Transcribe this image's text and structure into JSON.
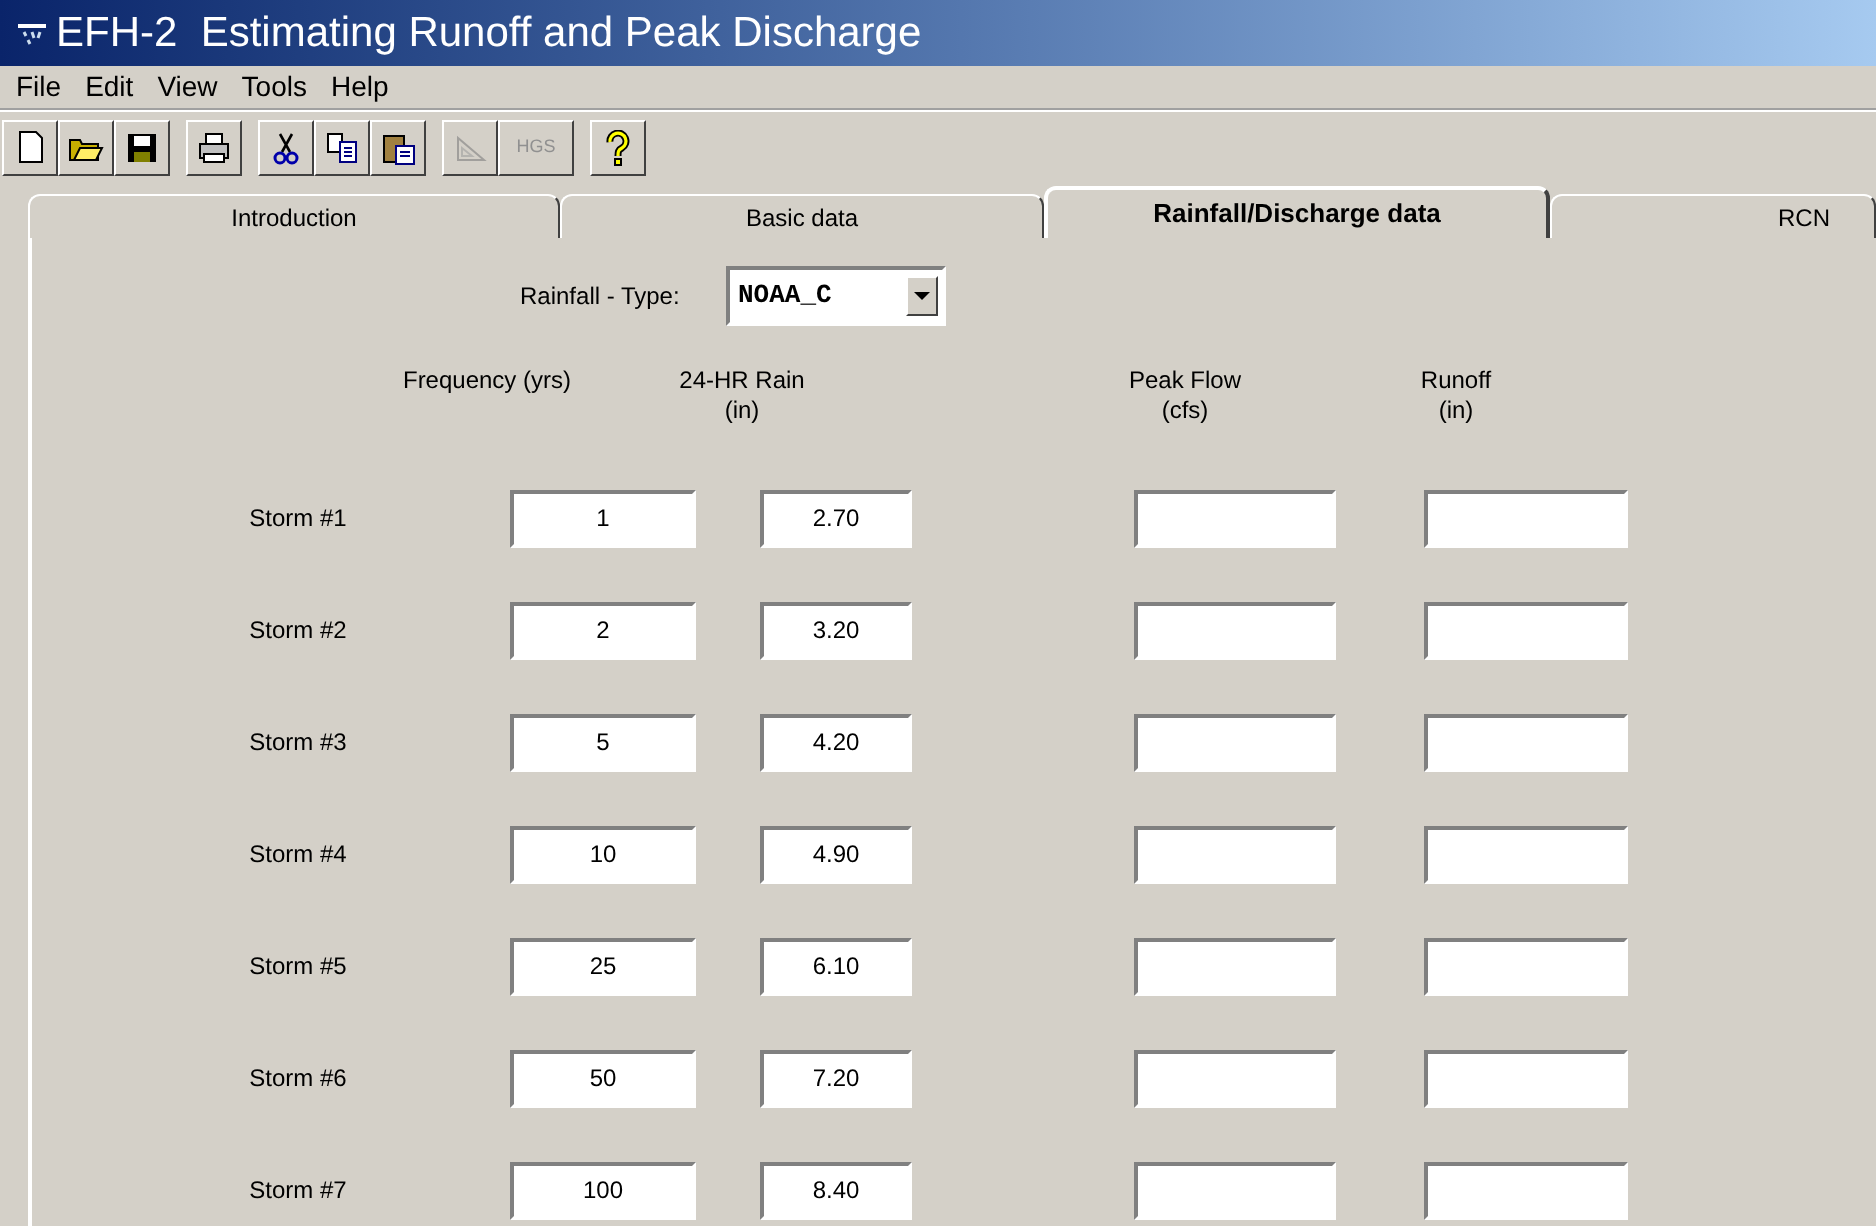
{
  "window": {
    "title": "EFH-2  Estimating Runoff and Peak Discharge"
  },
  "menu": [
    "File",
    "Edit",
    "View",
    "Tools",
    "Help"
  ],
  "toolbar": [
    {
      "kind": "new",
      "disabled": false
    },
    {
      "kind": "open",
      "disabled": false
    },
    {
      "kind": "save",
      "disabled": false
    },
    {
      "kind": "gap"
    },
    {
      "kind": "print",
      "disabled": false
    },
    {
      "kind": "gap"
    },
    {
      "kind": "cut",
      "disabled": false
    },
    {
      "kind": "copy",
      "disabled": false
    },
    {
      "kind": "paste",
      "disabled": false
    },
    {
      "kind": "gap"
    },
    {
      "kind": "triangle",
      "disabled": true
    },
    {
      "kind": "text",
      "label": "HGS",
      "disabled": true
    },
    {
      "kind": "gap"
    },
    {
      "kind": "help",
      "disabled": false
    }
  ],
  "tabs": [
    {
      "label": "Introduction",
      "selected": false
    },
    {
      "label": "Basic data",
      "selected": false
    },
    {
      "label": "Rainfall/Discharge data",
      "selected": true
    },
    {
      "label": "RCN",
      "selected": false
    }
  ],
  "rainfall_type": {
    "label": "Rainfall - Type:",
    "value": "NOAA_C"
  },
  "columns": [
    {
      "label": "Frequency (yrs)"
    },
    {
      "label": "24-HR Rain",
      "unit": "(in)"
    },
    {
      "label": "Peak Flow",
      "unit": "(cfs)"
    },
    {
      "label": "Runoff",
      "unit": "(in)"
    }
  ],
  "storms": [
    {
      "label": "Storm #1",
      "frequency": "1",
      "rain": "2.70"
    },
    {
      "label": "Storm #2",
      "frequency": "2",
      "rain": "3.20"
    },
    {
      "label": "Storm #3",
      "frequency": "5",
      "rain": "4.20"
    },
    {
      "label": "Storm #4",
      "frequency": "10",
      "rain": "4.90"
    },
    {
      "label": "Storm #5",
      "frequency": "25",
      "rain": "6.10"
    },
    {
      "label": "Storm #6",
      "frequency": "50",
      "rain": "7.20"
    },
    {
      "label": "Storm #7",
      "frequency": "100",
      "rain": "8.40"
    }
  ]
}
